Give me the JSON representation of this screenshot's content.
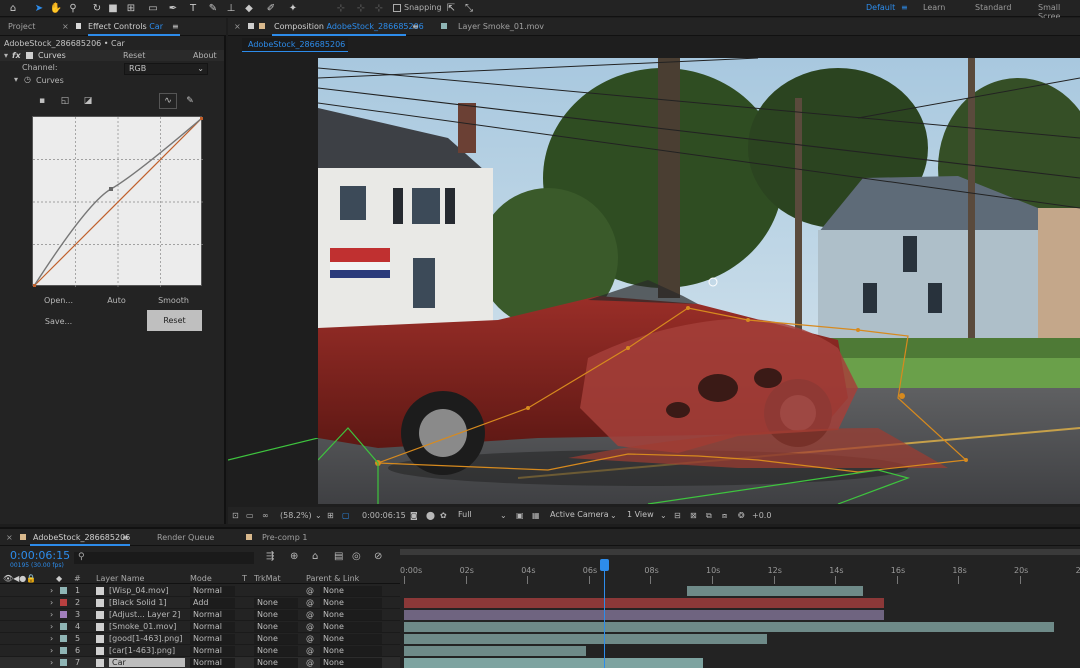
{
  "toolbar": {
    "tools": [
      "home-icon",
      "selection-icon",
      "hand-icon",
      "zoom-icon",
      "rotate-icon",
      "camera-icon",
      "pan-behind-icon",
      "mask-icon",
      "pen-icon",
      "type-icon",
      "brush-icon",
      "clone-icon",
      "eraser-icon",
      "roto-icon",
      "puppet-icon"
    ],
    "snapping_label": "Snapping",
    "workspaces": [
      "Default",
      "Learn",
      "Standard",
      "Small Scree"
    ],
    "active_workspace": "Default"
  },
  "left_panel": {
    "tabs": {
      "project": "Project",
      "effect_controls": "Effect Controls",
      "effect_target": "Car"
    },
    "subheader": "AdobeStock_286685206 • Car",
    "effect": {
      "fx": "fx",
      "name": "Curves",
      "reset": "Reset",
      "about": "About"
    },
    "channel_label": "Channel:",
    "channel_value": "RGB",
    "curves_label": "Curves",
    "buttons": {
      "open": "Open...",
      "auto": "Auto",
      "smooth": "Smooth",
      "save": "Save...",
      "reset": "Reset"
    }
  },
  "comp_panel": {
    "tab_prefix": "Composition",
    "tab_name": "AdobeStock_286685206",
    "layer_tab": "Layer Smoke_01.mov",
    "viewer_tab": "AdobeStock_286685206",
    "footer": {
      "zoom": "(58.2%)",
      "timecode": "0:00:06:15",
      "resolution": "Full",
      "camera": "Active Camera",
      "views": "1 View",
      "exposure": "+0.0"
    }
  },
  "timeline": {
    "tabs": {
      "comp": "AdobeStock_286685206",
      "render_queue": "Render Queue",
      "precomp": "Pre-comp 1"
    },
    "timecode": "0:00:06:15",
    "frames": "00195 (30.00 fps)",
    "columns": {
      "num": "#",
      "layer_name": "Layer Name",
      "mode": "Mode",
      "t": "T",
      "trkmat": "TrkMat",
      "parent": "Parent & Link"
    },
    "ruler": [
      "0:00s",
      "02s",
      "04s",
      "06s",
      "08s",
      "10s",
      "12s",
      "14s",
      "16s",
      "18s",
      "20s",
      "22"
    ],
    "layers": [
      {
        "num": "1",
        "name": "[Wisp_04.mov]",
        "mode": "Normal",
        "trkmat": "",
        "parent": "None",
        "label_color": "#8fb5b5",
        "bar_color": "#6e8a88",
        "bar_start_s": 9.2,
        "bar_end_s": 14.9
      },
      {
        "num": "2",
        "name": "[Black Solid 1]",
        "mode": "Add",
        "trkmat": "None",
        "parent": "None",
        "label_color": "#b84040",
        "bar_color": "#8b3838",
        "bar_start_s": 0.0,
        "bar_end_s": 15.6
      },
      {
        "num": "3",
        "name": "[Adjust... Layer 2]",
        "mode": "Normal",
        "trkmat": "None",
        "parent": "None",
        "label_color": "#a27fbd",
        "bar_color": "#6f6480",
        "bar_start_s": 0.0,
        "bar_end_s": 15.6
      },
      {
        "num": "4",
        "name": "[Smoke_01.mov]",
        "mode": "Normal",
        "trkmat": "None",
        "parent": "None",
        "label_color": "#8fb5b5",
        "bar_color": "#6e8a88",
        "bar_start_s": 0.0,
        "bar_end_s": 21.1
      },
      {
        "num": "5",
        "name": "[good[1-463].png]",
        "mode": "Normal",
        "trkmat": "None",
        "parent": "None",
        "label_color": "#8fb5b5",
        "bar_color": "#6e8a88",
        "bar_start_s": 0.0,
        "bar_end_s": 11.8
      },
      {
        "num": "6",
        "name": "[car[1-463].png]",
        "mode": "Normal",
        "trkmat": "None",
        "parent": "None",
        "label_color": "#8fb5b5",
        "bar_color": "#6e8a88",
        "bar_start_s": 0.0,
        "bar_end_s": 5.9
      },
      {
        "num": "7",
        "name": "Car",
        "mode": "Normal",
        "trkmat": "None",
        "parent": "None",
        "label_color": "#8fb5b5",
        "bar_color": "#7da3a0",
        "bar_start_s": 0.0,
        "bar_end_s": 9.7
      }
    ],
    "playhead_s": 6.5
  }
}
